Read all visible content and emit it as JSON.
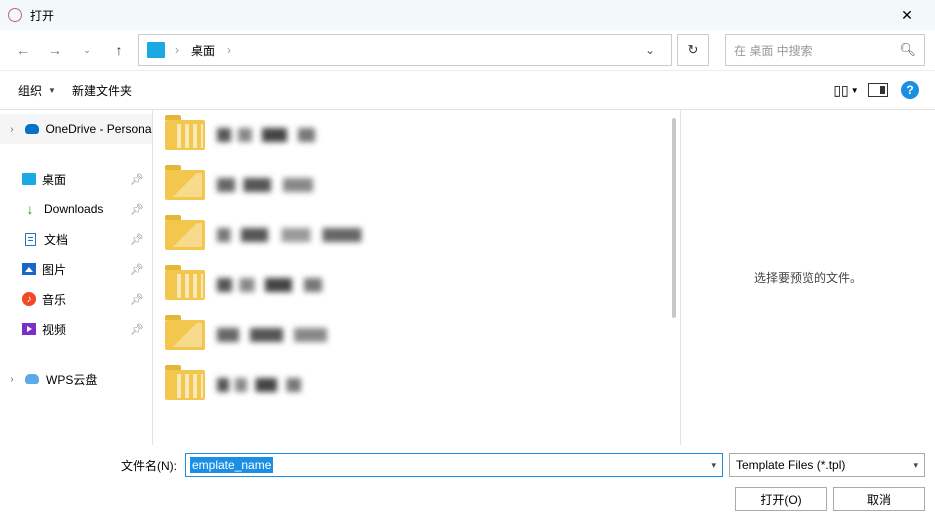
{
  "title": "打开",
  "breadcrumb": {
    "segments": [
      "桌面"
    ],
    "dropdown_indicator": "⌄"
  },
  "search": {
    "placeholder": "在 桌面 中搜索"
  },
  "toolbar": {
    "organize": "组织",
    "new_folder": "新建文件夹"
  },
  "sidebar": {
    "onedrive": "OneDrive - Personal",
    "quick": [
      {
        "label": "桌面",
        "icon": "desktop",
        "pinned": true
      },
      {
        "label": "Downloads",
        "icon": "download",
        "pinned": true
      },
      {
        "label": "文档",
        "icon": "docs",
        "pinned": true
      },
      {
        "label": "图片",
        "icon": "photos",
        "pinned": true
      },
      {
        "label": "音乐",
        "icon": "music",
        "pinned": true
      },
      {
        "label": "视频",
        "icon": "video",
        "pinned": true
      }
    ],
    "wps": "WPS云盘"
  },
  "preview": {
    "empty_message": "选择要预览的文件。"
  },
  "footer": {
    "filename_label": "文件名(N):",
    "filename_value": "emplate_name",
    "filetype": "Template Files (*.tpl)",
    "open": "打开(O)",
    "cancel": "取消"
  }
}
